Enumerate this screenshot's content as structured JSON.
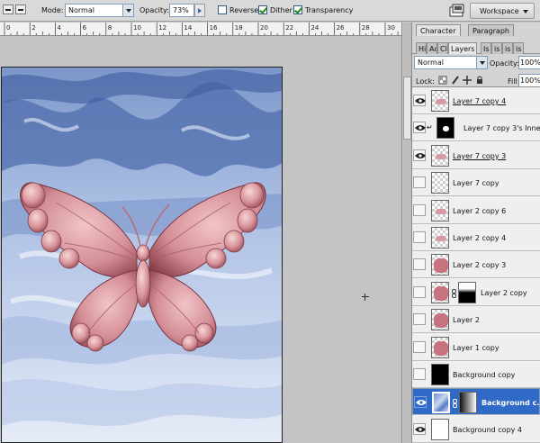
{
  "options_bar": {
    "mode_label": "Mode:",
    "mode_value": "Normal",
    "opacity_label": "Opacity:",
    "opacity_value": "73%",
    "reverse_label": "Reverse",
    "reverse_checked": false,
    "dither_label": "Dither",
    "dither_checked": true,
    "transparency_label": "Transparency",
    "transparency_checked": true,
    "workspace_label": "Workspace"
  },
  "ruler": {
    "labels": [
      "0",
      "2",
      "4",
      "6",
      "8",
      "10",
      "12",
      "14",
      "16",
      "18",
      "20",
      "22",
      "24",
      "26",
      "28",
      "30"
    ]
  },
  "panels": {
    "character_tabs": [
      "Character",
      "Paragraph"
    ],
    "layer_tabs": [
      "Hi",
      "Ac",
      "Cl",
      "Layers",
      "Is",
      "is",
      "is",
      "is"
    ],
    "active_layer_tab": "Layers",
    "blend_mode": "Normal",
    "opacity_label": "Opacity:",
    "opacity_value": "100%",
    "lock_label": "Lock:",
    "fill_label": "Fill:",
    "fill_value": "100%"
  },
  "layers": [
    {
      "name": "Layer 7 copy 4",
      "visible": true,
      "thumb": "checker-small",
      "underline": true
    },
    {
      "name": "Layer 7 copy 3's Inne...",
      "visible": true,
      "thumb": "black-shape",
      "clipped": true
    },
    {
      "name": "Layer 7 copy 3",
      "visible": true,
      "thumb": "checker-small",
      "underline": true
    },
    {
      "name": "Layer 7 copy",
      "visible": false,
      "thumb": "checker"
    },
    {
      "name": "Layer 2 copy 6",
      "visible": false,
      "thumb": "checker-small"
    },
    {
      "name": "Layer 2 copy 4",
      "visible": false,
      "thumb": "checker-small"
    },
    {
      "name": "Layer 2 copy 3",
      "visible": false,
      "thumb": "checker-big"
    },
    {
      "name": "Layer 2 copy",
      "visible": false,
      "thumb": "checker-big",
      "mask": true
    },
    {
      "name": "Layer 2",
      "visible": false,
      "thumb": "checker-big"
    },
    {
      "name": "Layer 1 copy",
      "visible": false,
      "thumb": "checker-big"
    },
    {
      "name": "Background copy",
      "visible": false,
      "thumb": "black"
    },
    {
      "name": "Background c...",
      "visible": true,
      "thumb": "blue",
      "mask": true,
      "selected": true
    },
    {
      "name": "Background copy 4",
      "visible": true,
      "thumb": "white"
    }
  ]
}
